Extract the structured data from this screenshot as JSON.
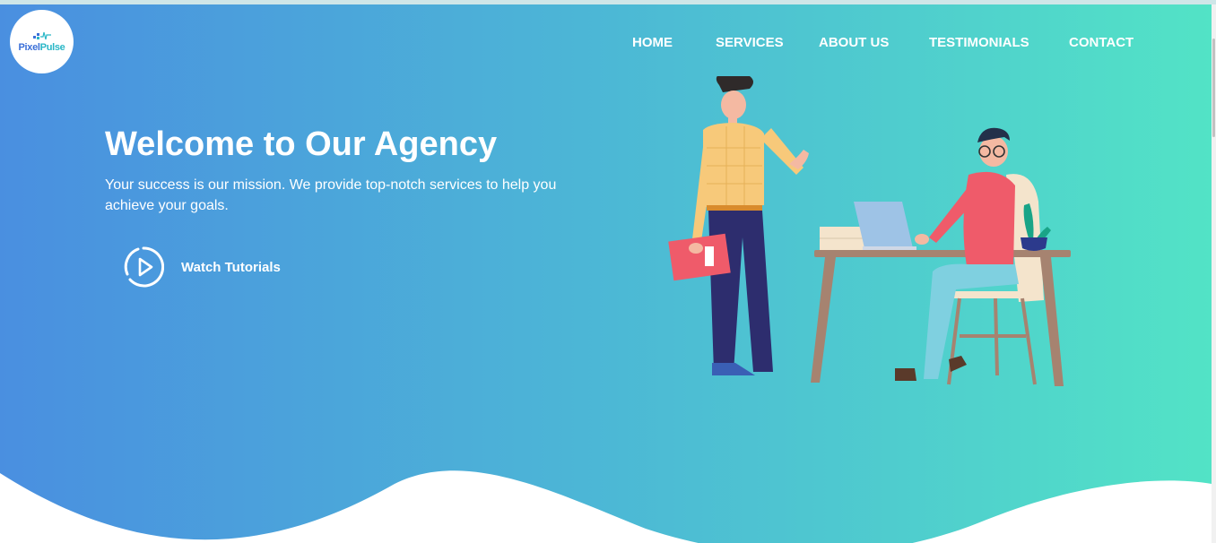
{
  "brand": {
    "part1": "Pixel",
    "part2": "Pulse"
  },
  "nav": {
    "items": [
      "HOME",
      "SERVICES",
      "ABOUT US",
      "TESTIMONIALS",
      "CONTACT"
    ]
  },
  "hero": {
    "headline": "Welcome to Our Agency",
    "subtitle": "Your success is our mission. We provide top-notch services to help you achieve your goals.",
    "cta_label": "Watch Tutorials",
    "cta_icon": "play-circle-icon"
  },
  "colors": {
    "gradient_start": "#4a8fe0",
    "gradient_mid": "#4cb6d6",
    "gradient_end": "#52e3c6",
    "text": "#ffffff",
    "logo_blue": "#3a6fd8",
    "logo_teal": "#2ab7c7"
  }
}
